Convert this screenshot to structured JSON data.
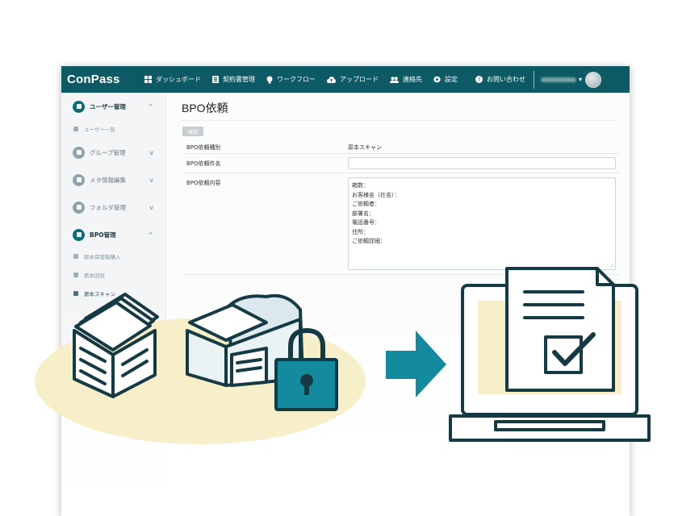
{
  "app": {
    "logo": "ConPass"
  },
  "nav": {
    "items": [
      {
        "label": "ダッシュボード",
        "icon": "dashboard-icon"
      },
      {
        "label": "契約書管理",
        "icon": "document-icon"
      },
      {
        "label": "ワークフロー",
        "icon": "lightbulb-icon"
      },
      {
        "label": "アップロード",
        "icon": "cloud-upload-icon"
      },
      {
        "label": "連絡先",
        "icon": "people-icon"
      },
      {
        "label": "設定",
        "icon": "gear-icon"
      }
    ],
    "contact": {
      "label": "お問い合わせ",
      "icon": "question-icon"
    },
    "user_caret": "▾"
  },
  "sidebar": {
    "sections": [
      {
        "label": "ユーザー管理",
        "chevron": "^",
        "active": true
      },
      {
        "label": "グループ管理",
        "chevron": "v",
        "active": false
      },
      {
        "label": "メタ情報編集",
        "chevron": "v",
        "active": false
      },
      {
        "label": "フォルダ管理",
        "chevron": "v",
        "active": false
      },
      {
        "label": "BPO管理",
        "chevron": "^",
        "active": true
      }
    ],
    "user_sub": {
      "label": "ユーザー一覧"
    },
    "bpo_subs": [
      {
        "label": "原本保管箱購入"
      },
      {
        "label": "原本回収"
      },
      {
        "label": "原本スキャン"
      }
    ]
  },
  "main": {
    "title": "BPO依頼",
    "confirm_button": "確認",
    "rows": {
      "type_label": "BPO依頼種別",
      "type_value": "原本スキャン",
      "name_label": "BPO依頼件名",
      "name_value": "",
      "content_label": "BPO依頼内容",
      "content_lines": [
        "箱数：",
        "お客様名（社名）：",
        "ご依頼者：",
        "部署名：",
        "電話番号：",
        "住所：",
        "ご依頼詳細："
      ]
    }
  },
  "colors": {
    "navbar": "#0d5964",
    "accent": "#0d6a76",
    "illustration_teal": "#138a9e",
    "illustration_dark": "#163a44",
    "ellipse": "#f6efc9"
  }
}
